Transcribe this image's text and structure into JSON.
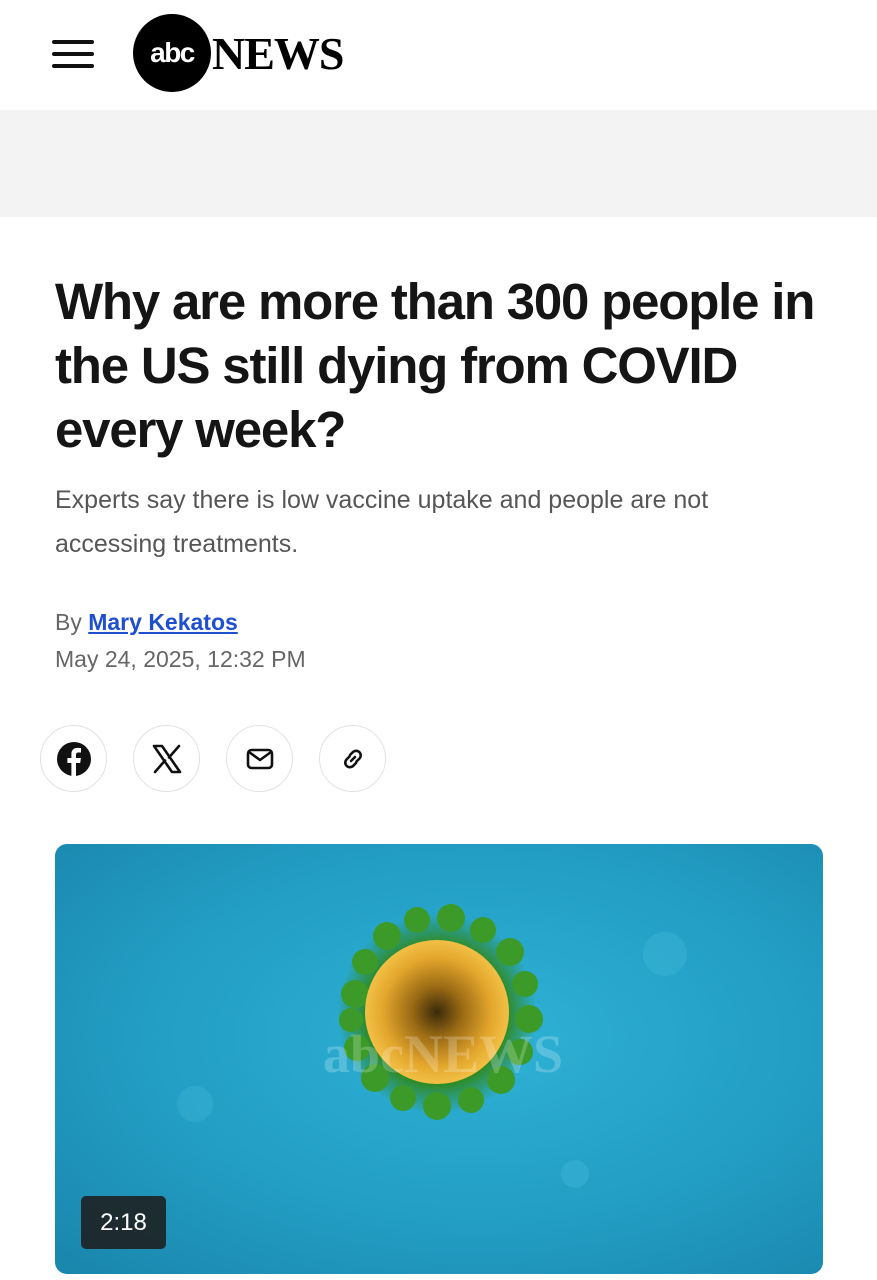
{
  "header": {
    "logo_abc": "abc",
    "logo_news": "NEWS",
    "menu_icon": "hamburger-menu-icon"
  },
  "article": {
    "title": "Why are more than 300 people in the US still dying from COVID every week?",
    "subtitle": "Experts say there is low vaccine uptake and people are not accessing treatments.",
    "byline_prefix": "By",
    "author": "Mary Kekatos",
    "date": "May 24, 2025, 12:32 PM"
  },
  "share": {
    "icons": [
      "facebook-icon",
      "x-icon",
      "mail-icon",
      "link-icon"
    ]
  },
  "media": {
    "duration": "2:18",
    "watermark": "abcNEWS"
  },
  "colors": {
    "author_link": "#1f4fd1",
    "ad_band": "#f3f3f4",
    "video_bg": "#2aa6c9"
  }
}
